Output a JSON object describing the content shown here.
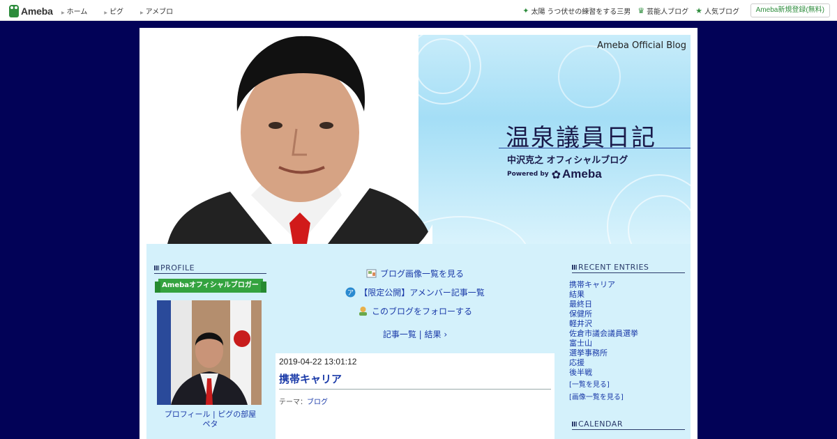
{
  "topbar": {
    "logo": "Ameba",
    "nav": [
      "ホーム",
      "ピグ",
      "アメブロ"
    ],
    "right_links": [
      {
        "icon": "sparkle-icon",
        "label": "太陽 うつ伏せの練習をする三男"
      },
      {
        "icon": "crown-icon",
        "label": "芸能人ブログ"
      },
      {
        "icon": "star-icon",
        "label": "人気ブログ"
      }
    ],
    "register": "Ameba新規登録(無料)"
  },
  "header": {
    "official": "Ameba Official Blog",
    "title": "温泉議員日記",
    "subtitle": "中沢克之 オフィシャルブログ",
    "powered_by": "Powered by",
    "powered_brand": "Ameba"
  },
  "profile": {
    "title": "PROFILE",
    "ribbon": "Amebaオフィシャルブロガー",
    "links": "プロフィール | ピグの部屋",
    "link2": "ペタ"
  },
  "center": {
    "links": [
      {
        "icon": "image-list-icon",
        "label": "ブログ画像一覧を見る"
      },
      {
        "icon": "amember-icon",
        "label": "【限定公開】アメンバー記事一覧"
      },
      {
        "icon": "follow-icon",
        "label": "このブログをフォローする"
      }
    ],
    "breadcrumb": "記事一覧 | 結果 ›",
    "article": {
      "date": "2019-04-22 13:01:12",
      "title": "携帯キャリア",
      "theme_label": "テーマ：",
      "theme": "ブログ"
    }
  },
  "recent": {
    "title": "RECENT ENTRIES",
    "entries": [
      "携帯キャリア",
      "結果",
      "最終日",
      "保健所",
      "軽井沢",
      "佐倉市議会議員選挙",
      "富士山",
      "選挙事務所",
      "応援",
      "後半戦"
    ],
    "more": "[一覧を見る]",
    "images": "[画像一覧を見る]"
  },
  "calendar": {
    "title": "CALENDAR"
  },
  "colors": {
    "background": "#020257",
    "sidebar_bg": "#d4f1fb",
    "link": "#1a3aa8",
    "ameba_green": "#2d8c3c"
  }
}
